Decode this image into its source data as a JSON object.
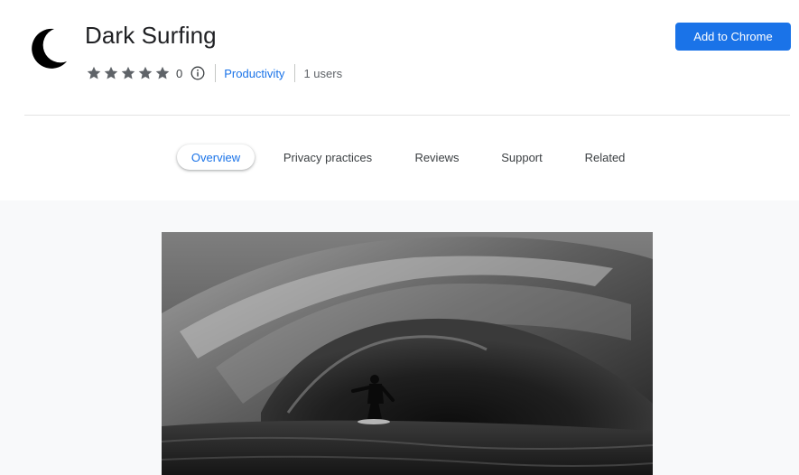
{
  "extension": {
    "name": "Dark Surfing",
    "icon": "crescent-moon-icon",
    "rating_count": "0",
    "category": "Productivity",
    "users": "1 users"
  },
  "actions": {
    "add_label": "Add to Chrome"
  },
  "tabs": [
    {
      "label": "Overview",
      "active": true
    },
    {
      "label": "Privacy practices"
    },
    {
      "label": "Reviews"
    },
    {
      "label": "Support"
    },
    {
      "label": "Related"
    }
  ],
  "colors": {
    "accent": "#1a73e8",
    "star": "#5f6368",
    "gallery_bg": "#f8f9fa"
  },
  "gallery": {
    "image": "surfer-in-wave-barrel-photo"
  }
}
